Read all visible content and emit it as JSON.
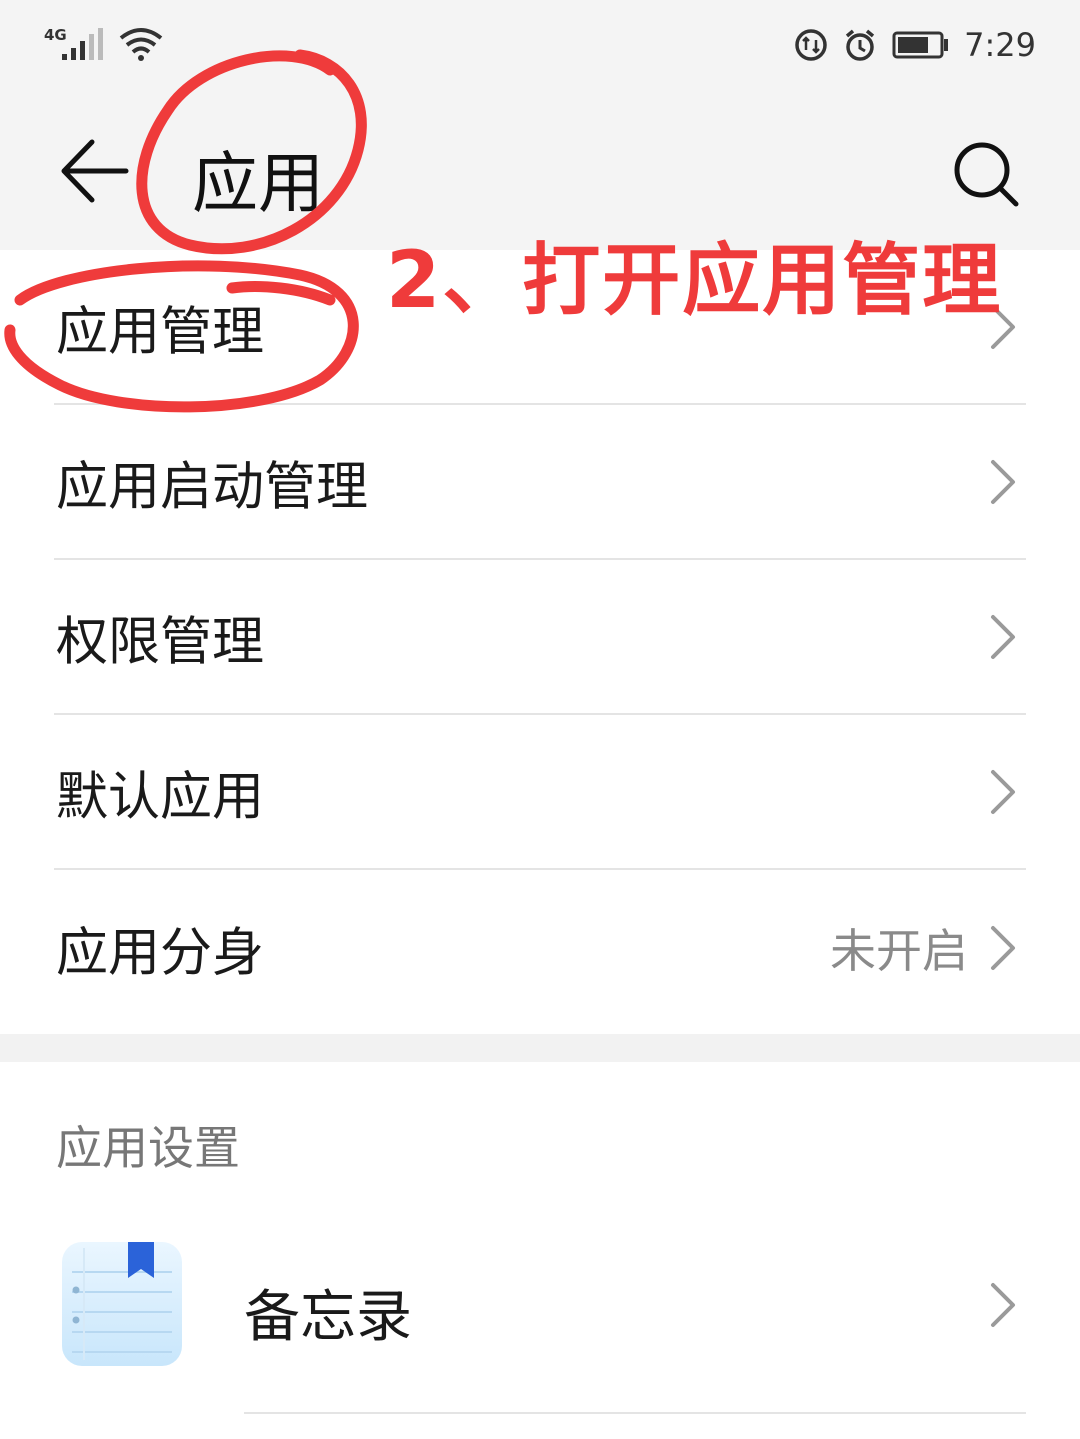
{
  "status_bar": {
    "network": "4G",
    "time": "7:29",
    "icons": [
      "signal-icon",
      "wifi-icon",
      "data-saver-icon",
      "alarm-icon",
      "battery-icon"
    ]
  },
  "header": {
    "title": "应用",
    "back_icon": "back-arrow-icon",
    "search_icon": "search-icon"
  },
  "annotation": {
    "text": "2、打开应用管理",
    "color": "#ef3b3b"
  },
  "menu": {
    "items": [
      {
        "label": "应用管理",
        "value": ""
      },
      {
        "label": "应用启动管理",
        "value": ""
      },
      {
        "label": "权限管理",
        "value": ""
      },
      {
        "label": "默认应用",
        "value": ""
      },
      {
        "label": "应用分身",
        "value": "未开启"
      }
    ]
  },
  "app_settings": {
    "section_title": "应用设置",
    "apps": [
      {
        "name": "备忘录",
        "icon": "notes-app-icon"
      }
    ]
  }
}
